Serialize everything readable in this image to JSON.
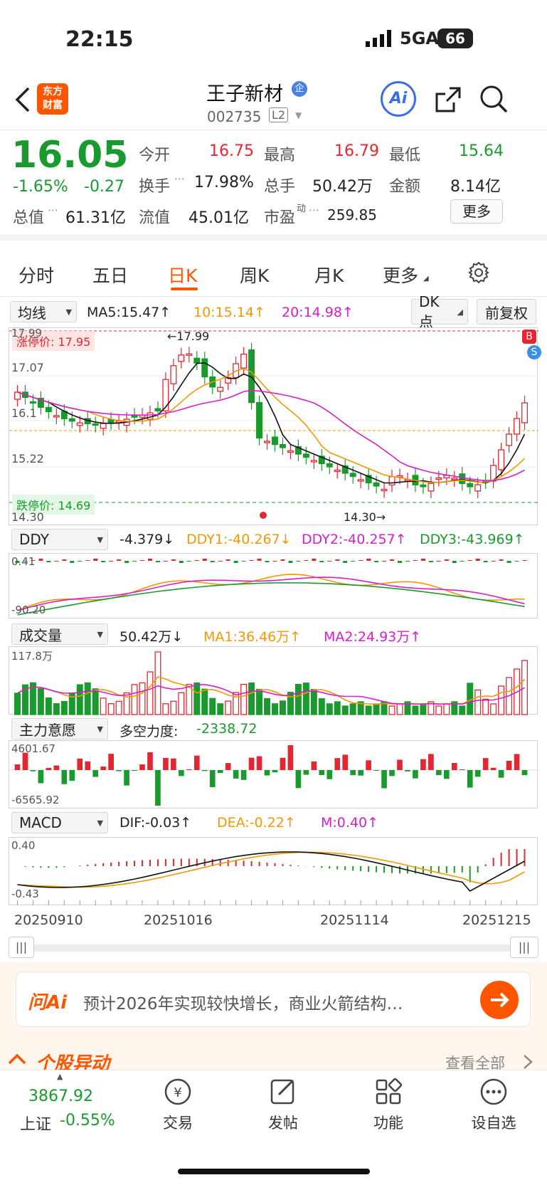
{
  "status_bar": {
    "time": "22:15",
    "network": "5GA",
    "battery": "66"
  },
  "header": {
    "logo_line1": "东方",
    "logo_line2": "财富",
    "stock_name": "王子新材",
    "badge": "企",
    "stock_code": "002735",
    "level": "L2",
    "ai_label": "Ai"
  },
  "quote": {
    "price": "16.05",
    "change_pct": "-1.65%",
    "change": "-0.27",
    "open_label": "今开",
    "open": "16.75",
    "high_label": "最高",
    "high": "16.79",
    "low_label": "最低",
    "low": "15.64",
    "turnover_label": "换手",
    "turnover": "17.98%",
    "volume_label": "总手",
    "volume": "50.42万",
    "amount_label": "金额",
    "amount": "8.14亿",
    "mktcap_label": "总值",
    "mktcap": "61.31亿",
    "float_label": "流值",
    "float": "45.01亿",
    "pe_label": "市盈",
    "pe_sup": "动",
    "pe": "259.85",
    "more_button": "更多"
  },
  "period_tabs": [
    "分时",
    "五日",
    "日K",
    "周K",
    "月K",
    "更多"
  ],
  "active_tab_index": 2,
  "kline": {
    "indicator_select": "均线",
    "ma5": "MA5:15.47↑",
    "ma10": "10:15.14↑",
    "ma20": "20:14.98↑",
    "dk_button": "DK点",
    "adjust_button": "前复权",
    "limit_up_label": "涨停价: 17.95",
    "limit_down_label": "跌停价: 14.69",
    "axis_top": "17.99",
    "axis_1": "17.07",
    "axis_2": "16.1",
    "axis_3": "15.22",
    "axis_bottom": "14.30",
    "max_mark": "←17.99",
    "min_mark": "14.30→",
    "b_marker": "B",
    "s_marker": "S"
  },
  "ddy": {
    "select": "DDY",
    "value": "-4.379↓",
    "ddy1": "DDY1:-40.267↓",
    "ddy2": "DDY2:-40.257↑",
    "ddy3": "DDY3:-43.969↑",
    "axis_top": "0.41",
    "axis_bottom": "-90.20"
  },
  "volume": {
    "select": "成交量",
    "value": "50.42万↓",
    "ma1": "MA1:36.46万↑",
    "ma2": "MA2:24.93万↑",
    "axis_top": "117.8万"
  },
  "mainforce": {
    "select": "主力意愿",
    "label": "多空力度:",
    "value": "-2338.72",
    "axis_top": "4601.67",
    "axis_bottom": "-6565.92"
  },
  "macd": {
    "select": "MACD",
    "dif": "DIF:-0.03↑",
    "dea": "DEA:-0.22↑",
    "m": "M:0.40↑",
    "axis_top": "0.40",
    "axis_bottom": "-0.43"
  },
  "dates": [
    "20250910",
    "20251016",
    "20251114",
    "20251215"
  ],
  "ai_banner": {
    "logo": "问Ai",
    "text": "预计2026年实现较快增长，商业火箭结构…"
  },
  "section": {
    "title": "个股异动",
    "more": "查看全部"
  },
  "bottom_nav": {
    "index_value": "3867.92",
    "index_name": "上证",
    "index_change": "-0.55%",
    "items": [
      "交易",
      "发帖",
      "功能",
      "设自选"
    ]
  },
  "colors": {
    "up": "#e3262f",
    "down": "#1a9a2e",
    "accent": "#ff6600",
    "ma10": "#f39800",
    "ma20": "#d81ec8"
  }
}
